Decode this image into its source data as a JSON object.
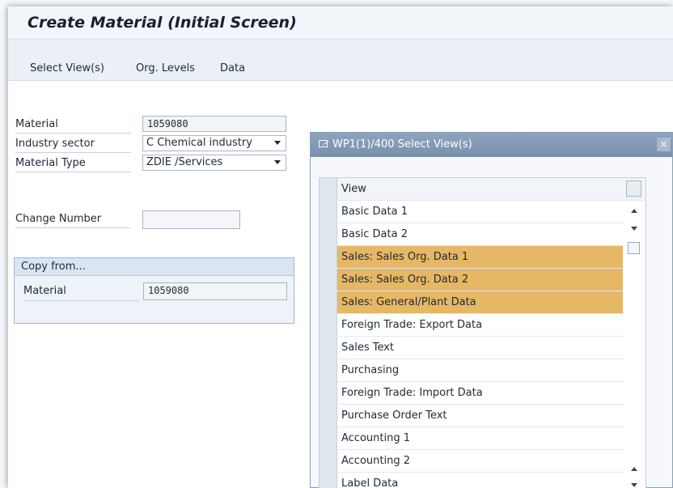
{
  "window": {
    "title": "Create Material (Initial Screen)"
  },
  "toolbar": {
    "select_views": "Select View(s)",
    "org_levels": "Org. Levels",
    "data": "Data"
  },
  "form": {
    "material_label": "Material",
    "material_value": "1059080",
    "industry_label": "Industry sector",
    "industry_value": "C Chemical industry",
    "type_label": "Material Type",
    "type_value": "ZDIE /Services",
    "change_label": "Change Number",
    "change_value": ""
  },
  "copy_from": {
    "header": "Copy from...",
    "material_label": "Material",
    "material_value": "1059080"
  },
  "dialog": {
    "title": "WP1(1)/400 Select View(s)",
    "close": "×",
    "column_header": "View",
    "views": [
      {
        "label": "Basic Data 1",
        "selected": false
      },
      {
        "label": "Basic Data 2",
        "selected": false
      },
      {
        "label": "Sales: Sales Org. Data 1",
        "selected": true
      },
      {
        "label": "Sales: Sales Org. Data 2",
        "selected": true
      },
      {
        "label": "Sales: General/Plant Data",
        "selected": true
      },
      {
        "label": "Foreign Trade: Export Data",
        "selected": false
      },
      {
        "label": "Sales Text",
        "selected": false
      },
      {
        "label": "Purchasing",
        "selected": false
      },
      {
        "label": "Foreign Trade: Import Data",
        "selected": false
      },
      {
        "label": "Purchase Order Text",
        "selected": false
      },
      {
        "label": "Accounting 1",
        "selected": false
      },
      {
        "label": "Accounting 2",
        "selected": false
      },
      {
        "label": "Label Data",
        "selected": false
      }
    ]
  },
  "colors": {
    "selected_row": "#e6b765",
    "dialog_title_bar": "#7f96b2",
    "toolbar_background": "#eaf0f6"
  }
}
